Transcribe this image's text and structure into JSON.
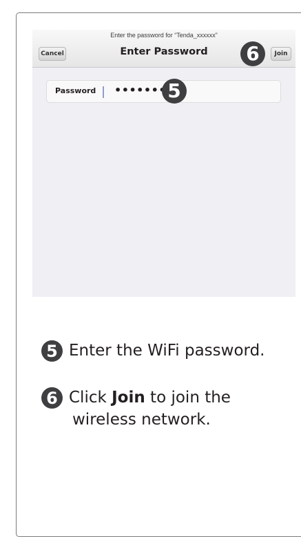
{
  "screen": {
    "prompt": "Enter the password for “Tenda_xxxxxx”",
    "title": "Enter Password",
    "cancel_label": "Cancel",
    "join_label": "Join",
    "password_label": "Password",
    "password_value": "••••••••"
  },
  "markers": {
    "five": "5",
    "six": "6"
  },
  "steps": {
    "step5_num": "5",
    "step5_text": "Enter the WiFi password.",
    "step6_num": "6",
    "step6_pre": "Click ",
    "step6_bold": "Join",
    "step6_post": " to join the",
    "step6_line2": "wireless network."
  }
}
